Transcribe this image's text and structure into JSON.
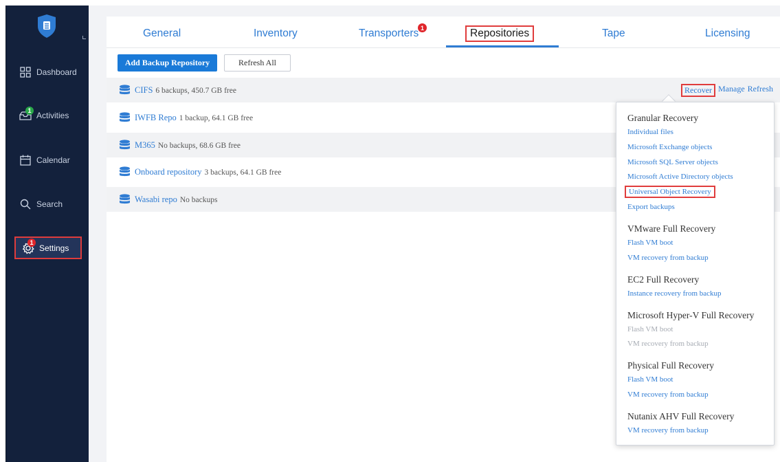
{
  "sidebar": {
    "items": [
      {
        "label": "Dashboard",
        "icon": "grid-icon"
      },
      {
        "label": "Activities",
        "icon": "activities-icon",
        "badge": "1",
        "badge_color": "#2aa84a"
      },
      {
        "label": "Calendar",
        "icon": "calendar-icon"
      },
      {
        "label": "Search",
        "icon": "search-icon"
      },
      {
        "label": "Settings",
        "icon": "gear-icon",
        "badge": "1",
        "badge_color": "#e0262b",
        "active": true
      }
    ]
  },
  "tabs": {
    "general": "General",
    "inventory": "Inventory",
    "transporters": "Transporters",
    "transporters_badge": "1",
    "repositories": "Repositories",
    "tape": "Tape",
    "licensing": "Licensing",
    "active": "Repositories"
  },
  "toolbar": {
    "add_label": "Add Backup Repository",
    "refresh_all_label": "Refresh All"
  },
  "repositories": [
    {
      "name": "CIFS",
      "info": "6 backups, 450.7 GB free"
    },
    {
      "name": "IWFB Repo",
      "info": "1 backup, 64.1 GB free"
    },
    {
      "name": "M365",
      "info": "No backups, 68.6 GB free"
    },
    {
      "name": "Onboard repository",
      "info": "3 backups, 64.1 GB free"
    },
    {
      "name": "Wasabi repo",
      "info": "No backups"
    }
  ],
  "row_actions": {
    "recover": "Recover",
    "manage": "Manage",
    "refresh": "Refresh"
  },
  "recover_menu": {
    "granular": {
      "title": "Granular Recovery",
      "items": [
        "Individual files",
        "Microsoft Exchange objects",
        "Microsoft SQL Server objects",
        "Microsoft Active Directory objects",
        "Universal Object Recovery",
        "Export backups"
      ]
    },
    "vmware": {
      "title": "VMware Full Recovery",
      "items": [
        "Flash VM boot",
        "VM recovery from backup"
      ]
    },
    "ec2": {
      "title": "EC2 Full Recovery",
      "items": [
        "Instance recovery from backup"
      ]
    },
    "hyperv": {
      "title": "Microsoft Hyper-V Full Recovery",
      "items": [
        "Flash VM boot",
        "VM recovery from backup"
      ],
      "disabled": true
    },
    "physical": {
      "title": "Physical Full Recovery",
      "items": [
        "Flash VM boot",
        "VM recovery from backup"
      ]
    },
    "nutanix": {
      "title": "Nutanix AHV Full Recovery",
      "items": [
        "VM recovery from backup"
      ]
    }
  },
  "colors": {
    "sidebar_bg": "#13213c",
    "accent": "#2f7cd3",
    "primary_button": "#1a7ad8",
    "highlight_box": "#e03c3c",
    "disabled_text": "#a6abb3"
  }
}
